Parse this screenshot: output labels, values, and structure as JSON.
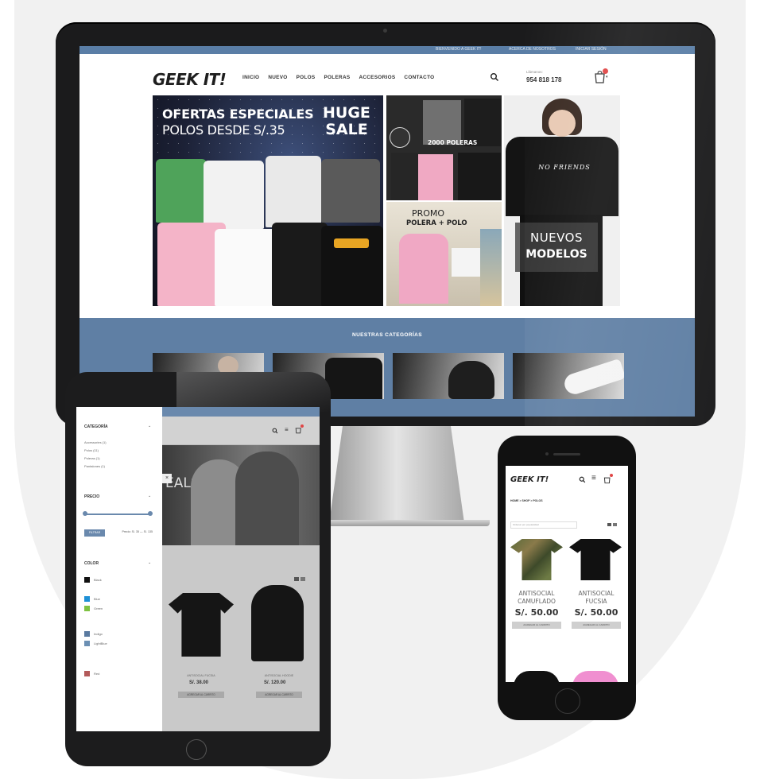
{
  "desktop": {
    "topbar": {
      "welcome": "BIENVENIDO A GEEK IT!",
      "about": "ACERCA DE NOSOTROS",
      "login": "INICIAR SESIÓN"
    },
    "header": {
      "logo": "GEEK IT!",
      "nav": [
        "INICIO",
        "NUEVO",
        "POLOS",
        "POLERAS",
        "ACCESORIOS",
        "CONTACTO"
      ],
      "phone_label": "Llámanos:",
      "phone": "954 818 178"
    },
    "hero": {
      "offers_title": "OFERTAS ESPECIALES",
      "offers_subtitle": "POLOS DESDE S/.35",
      "sale_line1": "HUGE",
      "sale_line2": "SALE",
      "poleras_promo": "2000 POLERAS",
      "promo_title": "PROMO",
      "promo_subtitle": "POLERA + POLO",
      "shirt_text": "NO FRIENDS",
      "new_line1": "NUEVOS",
      "new_line2": "MODELOS"
    },
    "categories_title": "NUESTRAS CATEGORÍAS"
  },
  "tablet": {
    "filters": {
      "category_title": "CATEGORÍA",
      "categories": [
        "Accessories (1)",
        "Polos (11)",
        "Poleras (1)",
        "Pantalones (1)"
      ],
      "price_title": "PRECIO",
      "filter_button": "FILTRAR",
      "price_range": "Precio: S/. 35 — S/. 135",
      "color_title": "COLOR",
      "colors": [
        {
          "name": "Black",
          "hex": "#111111"
        },
        {
          "name": "Blue",
          "hex": "#1e90d6"
        },
        {
          "name": "Green",
          "hex": "#7fc242"
        },
        {
          "name": "Indigo",
          "hex": "#5a7aa0"
        },
        {
          "name": "LightBlue",
          "hex": "#6b8fb3"
        },
        {
          "name": "Red",
          "hex": "#b35a5a"
        }
      ]
    },
    "banner_text": "EALS",
    "products": [
      {
        "name": "ANTISOCIAL FUCSIA",
        "price": "S/. 38.00",
        "button": "AGREGAR AL CARRITO"
      },
      {
        "name": "ANTISOCIAL HOODIE",
        "price": "S/. 120.00",
        "button": "AGREGAR AL CARRITO"
      }
    ]
  },
  "phone": {
    "logo": "GEEK IT!",
    "breadcrumb": "HOME > SHOP > POLOS",
    "sort_placeholder": "Ordenar por popularidad",
    "products": [
      {
        "name_line1": "ANTISOCIAL",
        "name_line2": "CAMUFLADO",
        "price": "S/. 50.00",
        "button": "AGREGAR AL CARRITO"
      },
      {
        "name_line1": "ANTISOCIAL",
        "name_line2": "FUCSIA",
        "price": "S/. 50.00",
        "button": "AGREGAR AL CARRITO"
      }
    ]
  },
  "colors": {
    "brand_blue": "#5f7fa4",
    "cart_badge": "#e04646"
  }
}
